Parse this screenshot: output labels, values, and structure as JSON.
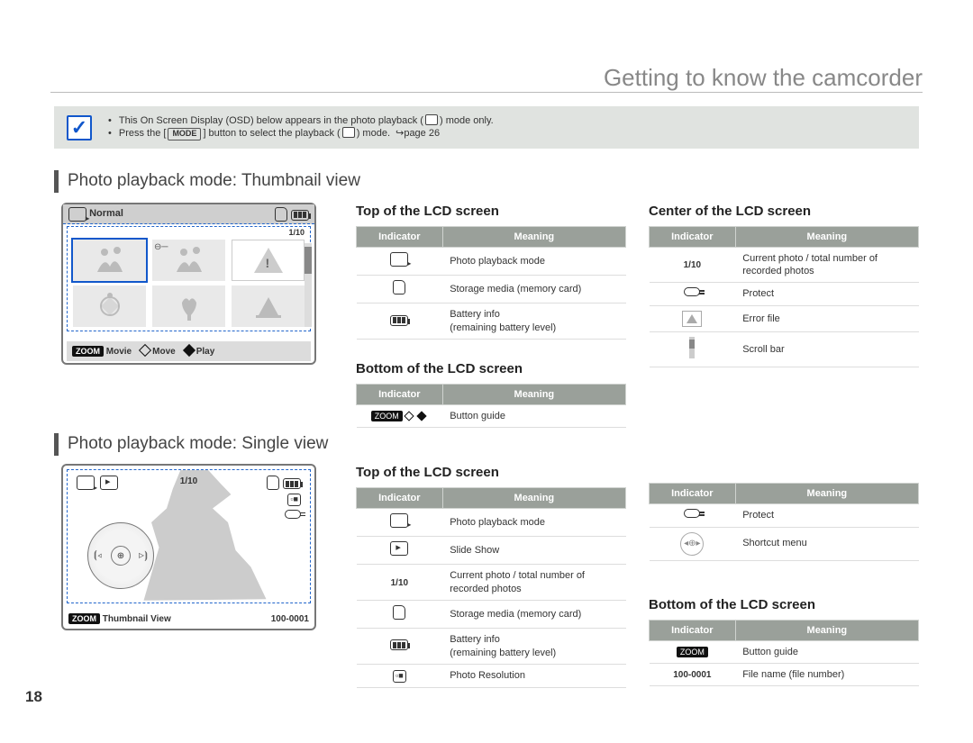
{
  "page": {
    "title": "Getting to know the camcorder",
    "number": "18"
  },
  "note": {
    "icon_label": "✓",
    "lines": [
      "This On Screen Display (OSD) below appears in the photo playback ( 📷 ) mode only.",
      "Press the [MODE] button to select the playback ( ▶ ) mode. ↪page 26"
    ],
    "mode_button": "MODE"
  },
  "sections": {
    "thumbnail": "Photo playback mode: Thumbnail view",
    "single": "Photo playback mode: Single view"
  },
  "lcd_thumb": {
    "normal": "Normal",
    "count": "1/10",
    "bottom": {
      "zoom": "ZOOM",
      "movie": "Movie",
      "move": "Move",
      "play": "Play"
    }
  },
  "lcd_single": {
    "count": "1/10",
    "thumb_view": "Thumbnail View",
    "file": "100-0001",
    "zoom": "ZOOM"
  },
  "tables": {
    "indicator": "Indicator",
    "meaning": "Meaning",
    "thumb_top_head": "Top of the LCD screen",
    "thumb_top": [
      {
        "meaning": "Photo playback mode"
      },
      {
        "meaning": "Storage media (memory card)"
      },
      {
        "meaning": "Battery info\n(remaining battery level)"
      }
    ],
    "thumb_bot_head": "Bottom of the LCD screen",
    "thumb_bot": [
      {
        "meaning": "Button guide"
      }
    ],
    "thumb_center_head": "Center of the LCD screen",
    "thumb_center": [
      {
        "ind": "1/10",
        "meaning": "Current photo / total number of recorded photos"
      },
      {
        "meaning": "Protect"
      },
      {
        "meaning": "Error file"
      },
      {
        "meaning": "Scroll bar"
      }
    ],
    "single_top_head": "Top of the LCD screen",
    "single_top": [
      {
        "meaning": "Photo playback mode"
      },
      {
        "meaning": "Slide Show"
      },
      {
        "ind": "1/10",
        "meaning": "Current photo / total number of recorded photos"
      },
      {
        "meaning": "Storage media (memory card)"
      },
      {
        "meaning": "Battery info\n(remaining battery level)"
      },
      {
        "meaning": "Photo Resolution"
      }
    ],
    "single_top_b": [
      {
        "meaning": "Protect"
      },
      {
        "meaning": "Shortcut menu"
      }
    ],
    "single_bot_head": "Bottom of the LCD screen",
    "single_bot": [
      {
        "meaning": "Button guide"
      },
      {
        "ind": "100-0001",
        "meaning": "File name (file number)"
      }
    ]
  }
}
